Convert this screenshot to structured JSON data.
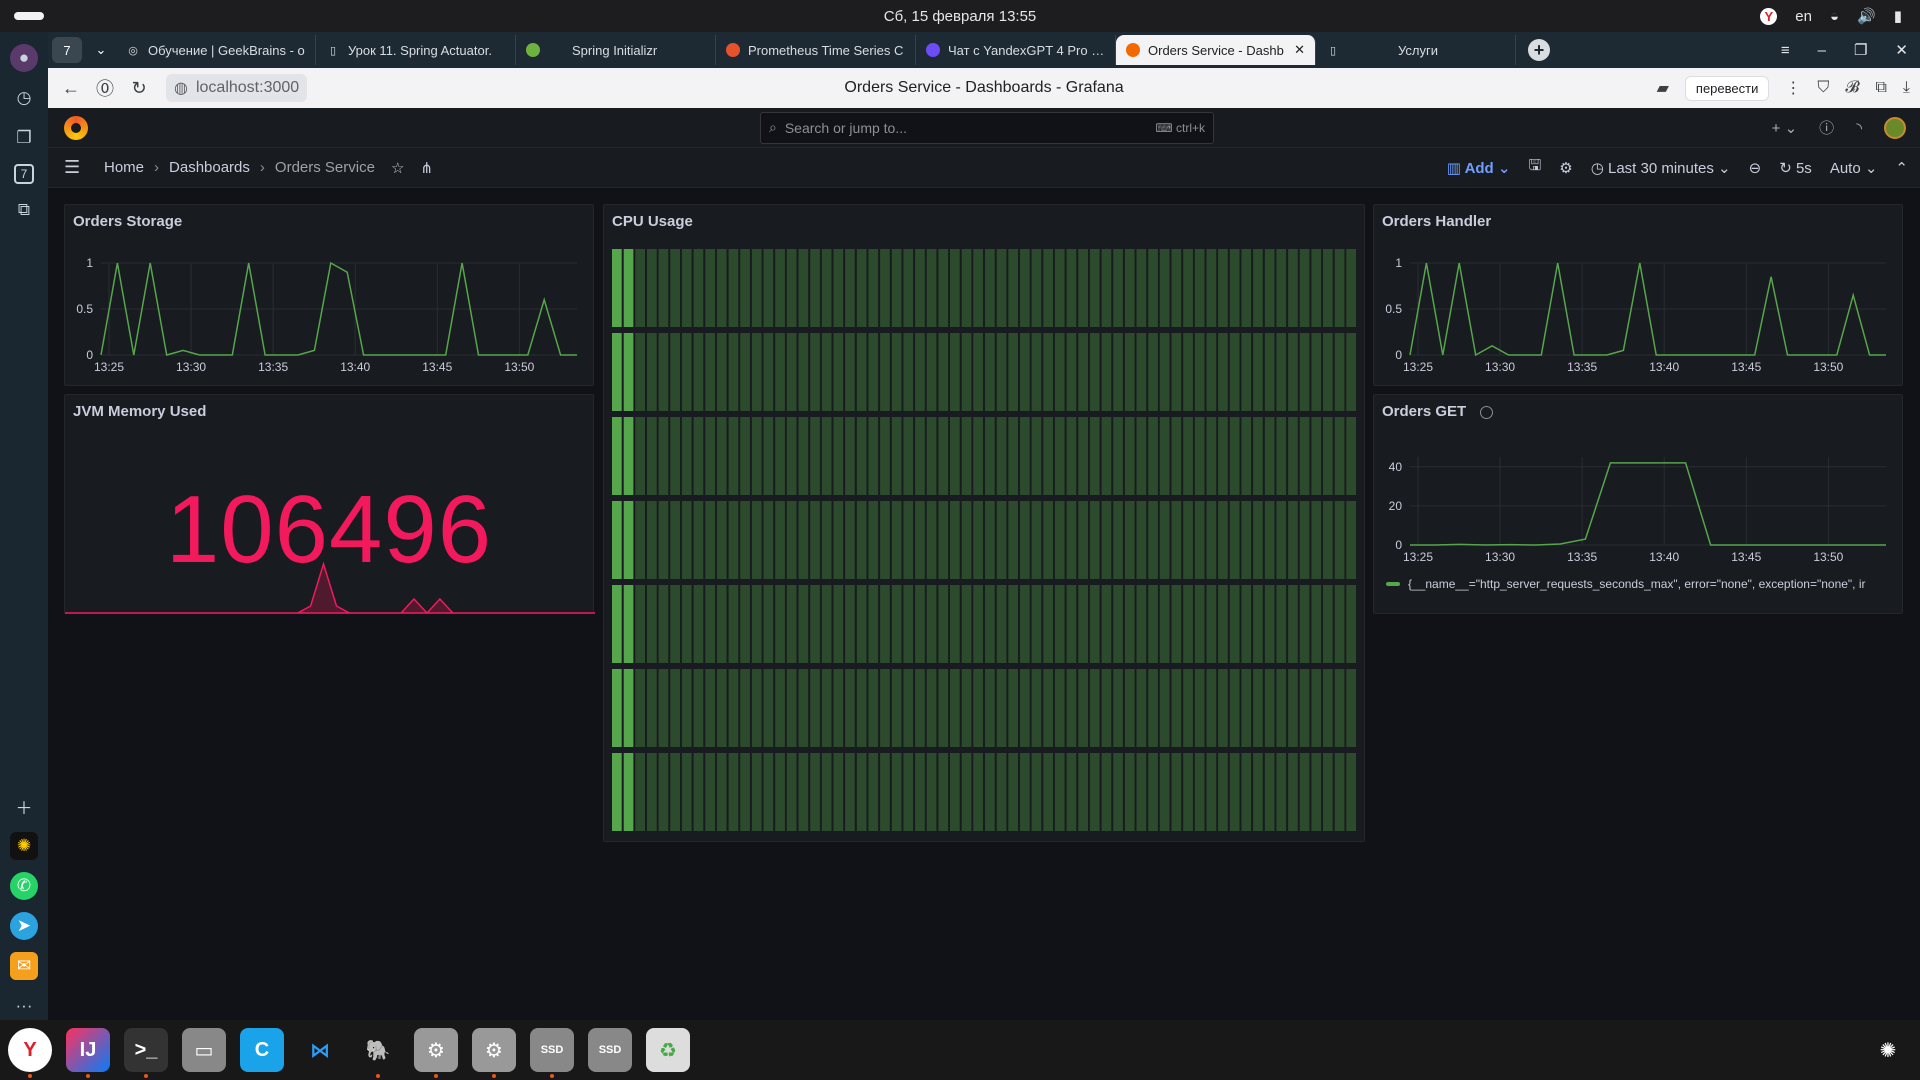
{
  "system_bar": {
    "datetime": "Сб, 15 февраля  13:55",
    "lang": "en"
  },
  "tabs": [
    {
      "label": "Обучение | GeekBrains - о",
      "icon": "geekbrains-icon"
    },
    {
      "label": "Урок 11. Spring Actuator.",
      "icon": "page-icon"
    },
    {
      "label": "Spring Initializr",
      "icon": "spring-icon"
    },
    {
      "label": "Prometheus Time Series C",
      "icon": "prometheus-icon"
    },
    {
      "label": "Чат с YandexGPT 4 Pro | Y",
      "icon": "yandexgpt-icon"
    },
    {
      "label": "Orders Service - Dashb",
      "icon": "grafana-icon",
      "active": true
    },
    {
      "label": "Услуги",
      "icon": "page-icon"
    }
  ],
  "tab_counter": "7",
  "address": {
    "url": "localhost:3000",
    "page_title": "Orders Service - Dashboards - Grafana",
    "translate_label": "перевести"
  },
  "grafana": {
    "search_placeholder": "Search or jump to...",
    "search_shortcut": "ctrl+k",
    "breadcrumb": [
      "Home",
      "Dashboards",
      "Orders Service"
    ],
    "add_label": "Add",
    "time_range": "Last 30 minutes",
    "refresh_interval": "5s",
    "refresh_mode": "Auto"
  },
  "panels": {
    "orders_storage": {
      "title": "Orders Storage"
    },
    "cpu_usage": {
      "title": "CPU Usage"
    },
    "orders_handler": {
      "title": "Orders Handler"
    },
    "jvm_memory": {
      "title": "JVM Memory Used",
      "value": "106496"
    },
    "orders_get": {
      "title": "Orders GET",
      "legend": "{__name__=\"http_server_requests_seconds_max\", error=\"none\", exception=\"none\", ir"
    }
  },
  "colors": {
    "series_green": "#56a64b",
    "stat_red": "#f2195c",
    "panel_bg": "#181b1f",
    "page_bg": "#111217",
    "cpu_bar": "#2c4a2c"
  },
  "chart_data": [
    {
      "type": "line",
      "panel": "Orders Storage",
      "x": [
        "13:25",
        "13:26",
        "13:27",
        "13:28",
        "13:29",
        "13:30",
        "13:31",
        "13:32",
        "13:33",
        "13:34",
        "13:35",
        "13:36",
        "13:37",
        "13:38",
        "13:39",
        "13:40",
        "13:41",
        "13:42",
        "13:43",
        "13:44",
        "13:45",
        "13:46",
        "13:47",
        "13:48",
        "13:49",
        "13:50",
        "13:51",
        "13:52",
        "13:53",
        "13:54"
      ],
      "series": [
        {
          "values": [
            0,
            1,
            0,
            1,
            0,
            0.05,
            0,
            0,
            0,
            1,
            0,
            0,
            0,
            0.05,
            1,
            0.9,
            0,
            0,
            0,
            0,
            0,
            0,
            1,
            0,
            0,
            0,
            0,
            0.6,
            0,
            0
          ]
        }
      ],
      "tick_labels_x": [
        "13:25",
        "13:30",
        "13:35",
        "13:40",
        "13:45",
        "13:50"
      ],
      "tick_labels_y": [
        "0",
        "0.5",
        "1"
      ],
      "ylim": [
        0,
        1
      ]
    },
    {
      "type": "line",
      "panel": "Orders Handler",
      "x": [
        "13:25",
        "13:26",
        "13:27",
        "13:28",
        "13:29",
        "13:30",
        "13:31",
        "13:32",
        "13:33",
        "13:34",
        "13:35",
        "13:36",
        "13:37",
        "13:38",
        "13:39",
        "13:40",
        "13:41",
        "13:42",
        "13:43",
        "13:44",
        "13:45",
        "13:46",
        "13:47",
        "13:48",
        "13:49",
        "13:50",
        "13:51",
        "13:52",
        "13:53",
        "13:54"
      ],
      "series": [
        {
          "values": [
            0,
            1,
            0,
            1,
            0,
            0.1,
            0,
            0,
            0,
            1,
            0,
            0,
            0,
            0.05,
            1,
            0,
            0,
            0,
            0,
            0,
            0,
            0,
            0.85,
            0,
            0,
            0,
            0,
            0.65,
            0,
            0
          ]
        }
      ],
      "tick_labels_x": [
        "13:25",
        "13:30",
        "13:35",
        "13:40",
        "13:45",
        "13:50"
      ],
      "tick_labels_y": [
        "0",
        "0.5",
        "1"
      ],
      "ylim": [
        0,
        1
      ]
    },
    {
      "type": "line",
      "panel": "Orders GET",
      "x": [
        "13:25",
        "13:27",
        "13:29",
        "13:31",
        "13:33",
        "13:35",
        "13:37",
        "13:38",
        "13:38.5",
        "13:39",
        "13:40",
        "13:41",
        "13:42",
        "13:43",
        "13:45",
        "13:47",
        "13:49",
        "13:51",
        "13:53",
        "13:54"
      ],
      "series": [
        {
          "values": [
            0,
            0,
            0.3,
            0,
            0.2,
            0,
            0.5,
            3,
            42,
            42,
            42,
            42,
            0,
            0,
            0,
            0,
            0,
            0,
            0,
            0
          ]
        }
      ],
      "tick_labels_x": [
        "13:25",
        "13:30",
        "13:35",
        "13:40",
        "13:45",
        "13:50"
      ],
      "tick_labels_y": [
        "0",
        "20",
        "40"
      ],
      "ylim": [
        0,
        45
      ]
    },
    {
      "type": "bar",
      "panel": "CPU Usage",
      "rows": 7,
      "bars_per_row": 64,
      "series": [
        {
          "values": [
            1,
            1,
            0.05,
            0.05,
            0.05,
            0.05,
            0.05,
            0.05
          ]
        }
      ]
    },
    {
      "type": "area",
      "panel": "JVM Memory Used (sparkline)",
      "series": [
        {
          "values": [
            0,
            0,
            0,
            0,
            0,
            0,
            0,
            0,
            0,
            0,
            0,
            0,
            0,
            0,
            0,
            0,
            0,
            0,
            0,
            0.05,
            0.35,
            0.05,
            0,
            0,
            0,
            0,
            0,
            0.1,
            0,
            0.1,
            0,
            0,
            0,
            0,
            0,
            0,
            0,
            0,
            0,
            0,
            0,
            0
          ]
        }
      ]
    }
  ]
}
